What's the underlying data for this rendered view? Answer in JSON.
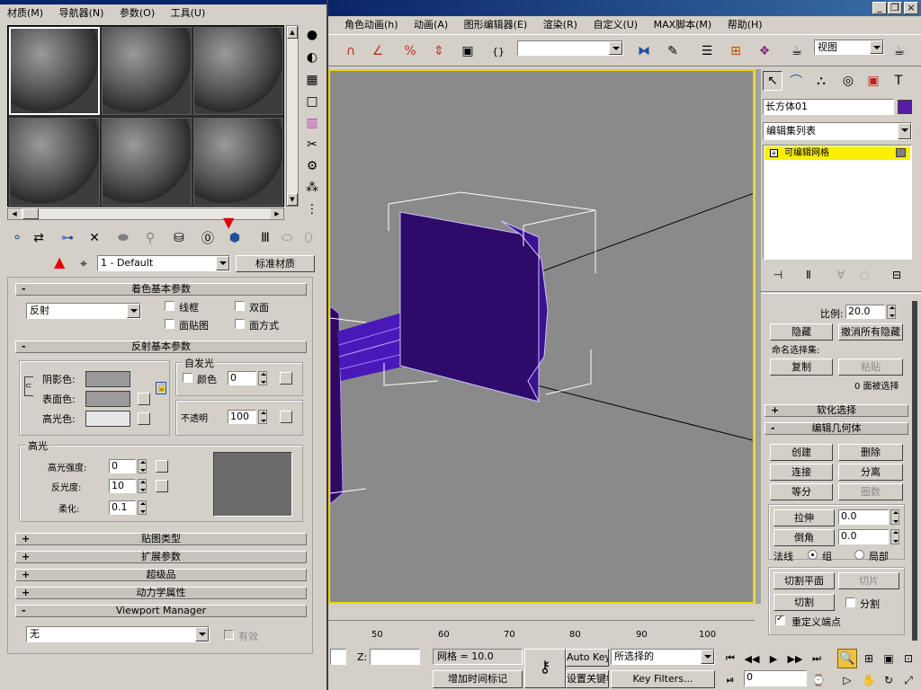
{
  "main_menu": [
    "角色动画(h)",
    "动画(A)",
    "图形编辑器(E)",
    "渲染(R)",
    "自定义(U)",
    "MAX脚本(M)",
    "帮助(H)"
  ],
  "toolbar": {
    "view_dropdown": "视图"
  },
  "viewport": {
    "ruler_ticks": [
      "50",
      "60",
      "70",
      "80",
      "90",
      "100"
    ]
  },
  "status_bar": {
    "z_label": "Z:",
    "grid": "网格 = 10.0",
    "add_time_tag": "增加时间标记",
    "auto_key": "Auto Key",
    "selection_set": "所选择的",
    "set_key": "设置关键帧",
    "key_filters": "Key Filters...",
    "frame": "0"
  },
  "command_panel": {
    "object_name": "长方体01",
    "object_color": "#5a1aa8",
    "modifier_list": "编辑集列表",
    "stack_item": "可编辑网格",
    "scale_label": "比例:",
    "scale_value": "20.0",
    "hide": "隐藏",
    "unhide_all": "撤消所有隐藏",
    "named_selections": "命名选择集:",
    "copy": "复制",
    "paste": "粘贴",
    "faces_selected": "0 面被选择",
    "soft_selection": "软化选择",
    "edit_geometry": "编辑几何体",
    "create": "创建",
    "delete": "删除",
    "attach": "连接",
    "detach": "分离",
    "divide": "等分",
    "turn": "圈数",
    "extrude": "拉伸",
    "extrude_value": "0.0",
    "chamfer": "倒角",
    "chamfer_value": "0.0",
    "normal_label": "法线",
    "group": "组",
    "local": "局部",
    "slice_plane": "切割平面",
    "slice": "切片",
    "cut": "切割",
    "split": "分割",
    "refine_ends": "重定义端点"
  },
  "material_editor": {
    "menu": [
      "材质(M)",
      "导航器(N)",
      "参数(O)",
      "工具(U)"
    ],
    "material_name": "1 - Default",
    "material_type": "标准材质",
    "shader_rollout": "着色基本参数",
    "shader": "反射",
    "wire": "线框",
    "two_sided": "双面",
    "face_map": "面贴图",
    "faceted": "面方式",
    "basic_rollout": "反射基本参数",
    "self_illum": "自发光",
    "color": "颜色",
    "self_illum_value": "0",
    "ambient": "阴影色:",
    "diffuse": "表面色:",
    "specular": "高光色:",
    "opacity": "不透明",
    "opacity_value": "100",
    "highlights": "高光",
    "spec_level": "高光强度:",
    "spec_level_value": "0",
    "glossiness": "反光度:",
    "glossiness_value": "10",
    "soften": "柔化:",
    "soften_value": "0.1",
    "maps_rollout": "贴图类型",
    "extended_rollout": "扩展参数",
    "supersampling_rollout": "超级品",
    "dynamics_rollout": "动力学属性",
    "viewport_manager": "Viewport Manager",
    "vm_dropdown": "无",
    "vm_enabled": "有效",
    "ambient_color": "#9a9a9a",
    "diffuse_color": "#9a9a9a",
    "specular_color": "#e6e6e6"
  }
}
